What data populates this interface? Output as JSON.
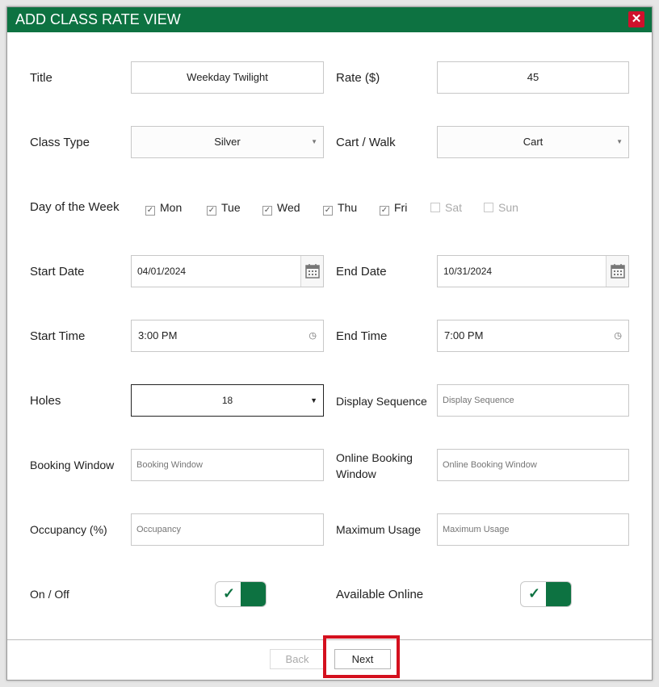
{
  "dialog": {
    "title": "ADD CLASS RATE VIEW",
    "close_icon": "close-icon"
  },
  "labels": {
    "title": "Title",
    "rate": "Rate ($)",
    "class_type": "Class Type",
    "cart_walk": "Cart / Walk",
    "day_of_week": "Day of the Week",
    "start_date": "Start Date",
    "end_date": "End Date",
    "start_time": "Start Time",
    "end_time": "End Time",
    "holes": "Holes",
    "display_sequence": "Display Sequence",
    "booking_window": "Booking Window",
    "online_booking_window": "Online Booking Window",
    "occupancy": "Occupancy (%)",
    "maximum_usage": "Maximum Usage",
    "on_off": "On / Off",
    "available_online": "Available Online"
  },
  "fields": {
    "title": "Weekday Twilight",
    "rate": "45",
    "class_type": "Silver",
    "cart_walk": "Cart",
    "start_date": "04/01/2024",
    "end_date": "10/31/2024",
    "start_time": "3:00 PM",
    "end_time": "7:00 PM",
    "holes": "18"
  },
  "placeholders": {
    "display_sequence": "Display Sequence",
    "booking_window": "Booking Window",
    "online_booking_window": "Online Booking Window",
    "occupancy": "Occupancy",
    "maximum_usage": "Maximum Usage"
  },
  "days": [
    {
      "label": "Mon",
      "checked": true,
      "enabled": true
    },
    {
      "label": "Tue",
      "checked": true,
      "enabled": true
    },
    {
      "label": "Wed",
      "checked": true,
      "enabled": true
    },
    {
      "label": "Thu",
      "checked": true,
      "enabled": true
    },
    {
      "label": "Fri",
      "checked": true,
      "enabled": true
    },
    {
      "label": "Sat",
      "checked": false,
      "enabled": false
    },
    {
      "label": "Sun",
      "checked": false,
      "enabled": false
    }
  ],
  "toggles": {
    "on_off": true,
    "available_online": true
  },
  "buttons": {
    "back": "Back",
    "next": "Next"
  },
  "colors": {
    "header": "#0d7241",
    "close": "#d0102c",
    "highlight": "#d4101e",
    "toggle_on": "#0d7241"
  }
}
